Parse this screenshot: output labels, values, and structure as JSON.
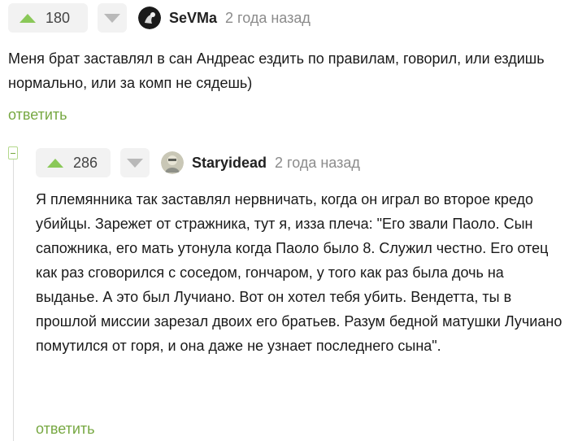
{
  "comment1": {
    "rating": "180",
    "username": "SeVMa",
    "time": "2 года назад",
    "text": "Меня брат заставлял в сан Андреас ездить по правилам, говорил, или ездишь нормально, или за комп не сядешь)",
    "reply_label": "ответить"
  },
  "comment2": {
    "rating": "286",
    "username": "Staryidead",
    "time": "2 года назад",
    "text": "Я племянника так заставлял нервничать, когда он играл во второе кредо убийцы. Зарежет от стражника, тут я, изза плеча: \"Его звали Паоло. Сын сапожника, его мать утонула когда Паоло было 8. Служил честно. Его отец как раз сговорился с соседом, гончаром, у того как раз была дочь на выданье. А это был Лучиано. Вот он хотел тебя убить. Вендетта, ты в прошлой миссии зарезал двоих его братьев. Разум бедной матушки Лучиано помутился от горя, и она даже не узнает последнего сына\".",
    "reply_label": "ответить"
  },
  "colors": {
    "accent": "#77a842",
    "upvote": "#8ac858",
    "muted": "#8b8b8b"
  }
}
